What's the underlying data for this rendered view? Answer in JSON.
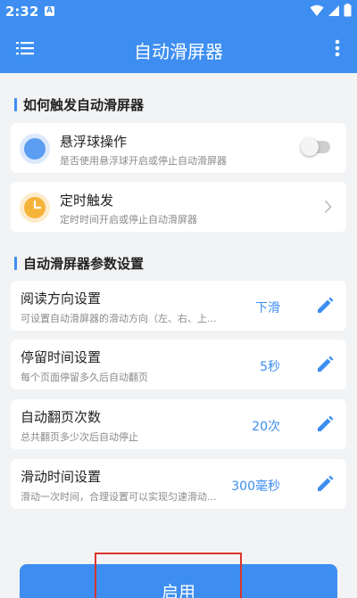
{
  "status_bar": {
    "time": "2:32",
    "notif_letter": "A"
  },
  "app_bar": {
    "title": "自动滑屏器"
  },
  "sections": {
    "trigger_title": "如何触发自动滑屏器",
    "params_title": "自动滑屏器参数设置"
  },
  "trigger": {
    "float_ball": {
      "title": "悬浮球操作",
      "subtitle": "是否使用悬浮球开启或停止自动滑屏器",
      "enabled": false
    },
    "timer": {
      "title": "定时触发",
      "subtitle": "定时时间开启或停止自动滑屏器"
    }
  },
  "params": [
    {
      "title": "阅读方向设置",
      "subtitle": "可设置自动滑屏器的滑动方向（左、右、上...",
      "value": "下滑"
    },
    {
      "title": "停留时间设置",
      "subtitle": "每个页面停留多久后自动翻页",
      "value": "5秒"
    },
    {
      "title": "自动翻页次数",
      "subtitle": "总共翻页多少次后自动停止",
      "value": "20次"
    },
    {
      "title": "滑动时间设置",
      "subtitle": "滑动一次时间，合理设置可以实现匀速滑动...",
      "value": "300毫秒"
    }
  ],
  "start_button": {
    "label": "启用"
  },
  "colors": {
    "primary": "#3d8ef0",
    "float_icon": "#5b9df0",
    "timer_icon": "#f6b33a",
    "highlight": "#d9342b"
  },
  "icons": [
    "menu-icon",
    "more-vert-icon",
    "float-ball-icon",
    "clock-icon",
    "chevron-right-icon",
    "pencil-icon",
    "wifi-icon",
    "signal-icon",
    "battery-icon"
  ]
}
